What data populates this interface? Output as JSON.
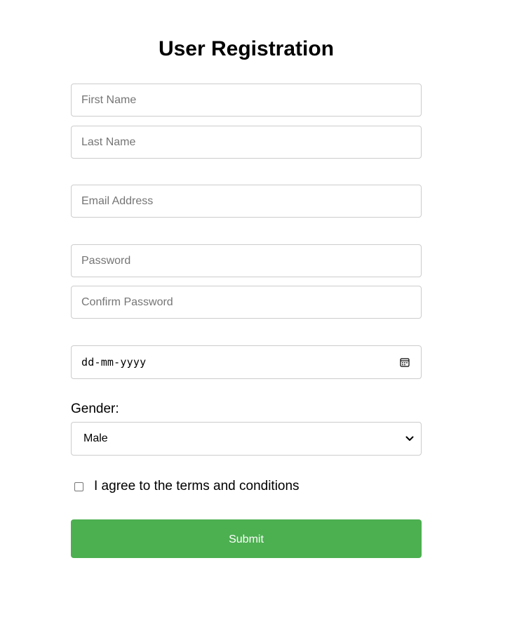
{
  "form": {
    "title": "User Registration",
    "first_name": {
      "placeholder": "First Name",
      "value": ""
    },
    "last_name": {
      "placeholder": "Last Name",
      "value": ""
    },
    "email": {
      "placeholder": "Email Address",
      "value": ""
    },
    "password": {
      "placeholder": "Password",
      "value": ""
    },
    "confirm_password": {
      "placeholder": "Confirm Password",
      "value": ""
    },
    "dob": {
      "placeholder": "dd-mm-yyyy",
      "icon": "calendar-icon"
    },
    "gender": {
      "label": "Gender:",
      "selected": "Male",
      "icon": "chevron-down-icon"
    },
    "terms": {
      "label": "I agree to the terms and conditions",
      "checked": false
    },
    "submit_label": "Submit"
  },
  "colors": {
    "accent": "#4caf50",
    "border": "#cccccc",
    "placeholder": "#757575",
    "text": "#000000"
  }
}
